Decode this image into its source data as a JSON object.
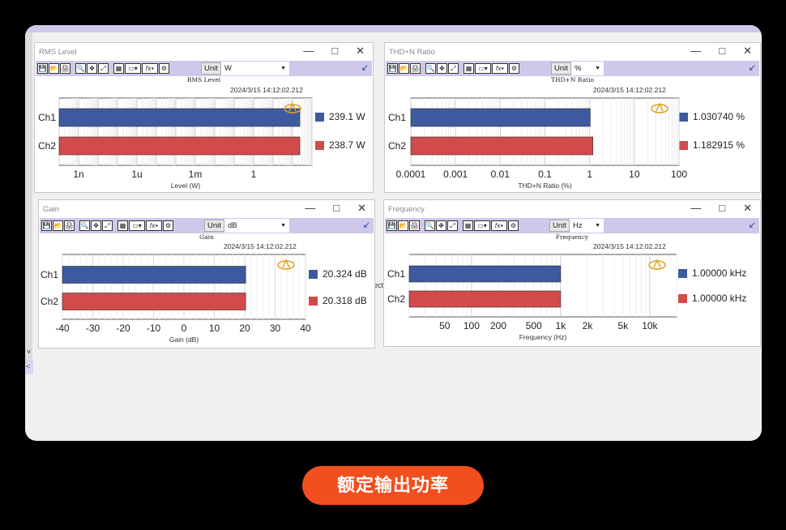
{
  "footer": {
    "caption": "额定输出功率"
  },
  "stray_text": "ect",
  "toolbar": {
    "unit_label": "Unit",
    "icon_labels": [
      "💾",
      "📂",
      "🖨",
      "🔍",
      "✥",
      "⤢",
      "▦",
      "▭▾",
      "𝑓x▾",
      "⚙"
    ]
  },
  "legend_colors": {
    "ch1": "#3d5a9e",
    "ch2": "#d14b4b"
  },
  "panels": [
    {
      "id": "rms",
      "window_title": "RMS Level",
      "unit": "W",
      "chart_data": {
        "type": "bar",
        "orientation": "horizontal",
        "title": "RMS Level",
        "timestamp": "2024/3/15 14:12:02.212",
        "xlabel": "Level (W)",
        "xscale": "log",
        "categories": [
          "Ch1",
          "Ch2"
        ],
        "values": [
          239.1,
          238.7
        ],
        "value_labels": [
          "239.1 W",
          "238.7 W"
        ],
        "tick_labels": [
          "1n",
          "1u",
          "1m",
          "1"
        ],
        "xlim": [
          1e-10,
          1000
        ],
        "grid": true,
        "legend_placement": "right"
      }
    },
    {
      "id": "thdn",
      "window_title": "THD+N Ratio",
      "unit": "%",
      "chart_data": {
        "type": "bar",
        "orientation": "horizontal",
        "title": "THD+N Ratio",
        "timestamp": "2024/3/15 14:12:02.212",
        "xlabel": "THD+N Ratio (%)",
        "xscale": "log",
        "categories": [
          "Ch1",
          "Ch2"
        ],
        "values": [
          1.03074,
          1.182915
        ],
        "value_labels": [
          "1.030740 %",
          "1.182915 %"
        ],
        "tick_labels": [
          "0.0001",
          "0.001",
          "0.01",
          "0.1",
          "1",
          "10",
          "100"
        ],
        "xlim": [
          0.0001,
          100
        ],
        "grid": true,
        "legend_placement": "right"
      }
    },
    {
      "id": "gain",
      "window_title": "Gain",
      "unit": "dB",
      "chart_data": {
        "type": "bar",
        "orientation": "horizontal",
        "title": "Gain",
        "timestamp": "2024/3/15 14:12:02.212",
        "xlabel": "Gain (dB)",
        "xscale": "linear",
        "categories": [
          "Ch1",
          "Ch2"
        ],
        "values": [
          20.324,
          20.318
        ],
        "value_labels": [
          "20.324 dB",
          "20.318 dB"
        ],
        "tick_labels": [
          "-40",
          "-30",
          "-20",
          "-10",
          "0",
          "10",
          "20",
          "30",
          "40"
        ],
        "xlim": [
          -40,
          40
        ],
        "grid": true,
        "legend_placement": "right"
      }
    },
    {
      "id": "freq",
      "window_title": "Frequency",
      "unit": "Hz",
      "chart_data": {
        "type": "bar",
        "orientation": "horizontal",
        "title": "Frequency",
        "timestamp": "2024/3/15 14:12:02.212",
        "xlabel": "Frequency (Hz)",
        "xscale": "log",
        "categories": [
          "Ch1",
          "Ch2"
        ],
        "values": [
          1000,
          1000
        ],
        "value_labels": [
          "1.00000 kHz",
          "1.00000 kHz"
        ],
        "tick_labels": [
          "50",
          "100",
          "200",
          "500",
          "1k",
          "2k",
          "5k",
          "10k"
        ],
        "tick_values": [
          50,
          100,
          200,
          500,
          1000,
          2000,
          5000,
          10000
        ],
        "xlim": [
          20,
          20000
        ],
        "grid": true,
        "legend_placement": "right"
      }
    }
  ]
}
